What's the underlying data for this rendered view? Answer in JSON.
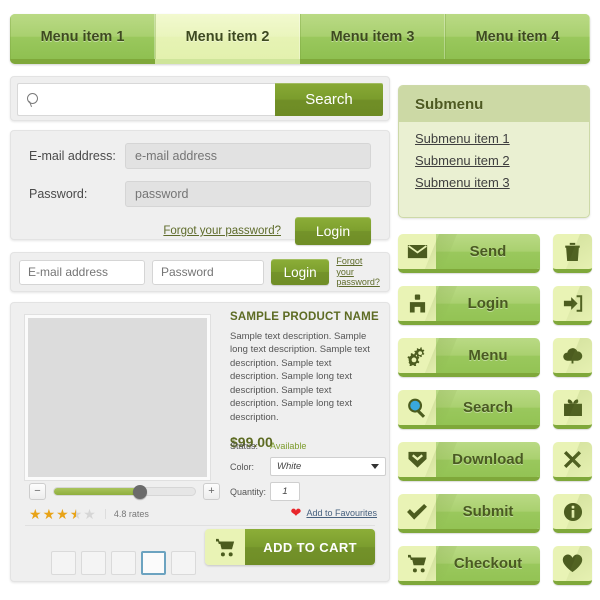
{
  "menu": {
    "items": [
      {
        "label": "Menu item 1",
        "active": false
      },
      {
        "label": "Menu item 2",
        "active": true
      },
      {
        "label": "Menu item 3",
        "active": false
      },
      {
        "label": "Menu item 4",
        "active": false
      }
    ]
  },
  "search": {
    "icon": "search-icon",
    "value": "",
    "placeholder": "",
    "button_label": "Search"
  },
  "login_form": {
    "email_label": "E-mail address:",
    "email_placeholder": "e-mail address",
    "email_value": "",
    "password_label": "Password:",
    "password_placeholder": "password",
    "password_value": "",
    "forgot_label": "Forgot your password?",
    "login_label": "Login"
  },
  "login_bar": {
    "email_placeholder": "E-mail address",
    "email_value": "",
    "password_placeholder": "Password",
    "password_value": "",
    "login_label": "Login",
    "forgot_label": "Forgot your password?"
  },
  "product": {
    "title": "SAMPLE PRODUCT NAME",
    "description": "Sample text description. Sample long text description. Sample text description. Sample text description. Sample long text description. Sample text description. Sample long text description.",
    "price": "$99.00",
    "status_label": "Status:",
    "status_value": "Available",
    "color_label": "Color:",
    "color_value": "White",
    "quantity_label": "Quantity:",
    "quantity_value": "1",
    "thumbnails": [
      {
        "selected": false
      },
      {
        "selected": false
      },
      {
        "selected": false
      },
      {
        "selected": true
      },
      {
        "selected": false
      }
    ],
    "slider": {
      "minus_label": "−",
      "plus_label": "+",
      "percent": 60
    },
    "rating": {
      "stars": [
        1,
        1,
        1,
        0.5,
        0
      ],
      "text": "4.8 rates"
    },
    "favourites": {
      "icon": "heart-icon",
      "label": "Add to Favourites"
    },
    "add_to_cart": {
      "icon": "cart-icon",
      "label": "ADD TO CART"
    }
  },
  "submenu": {
    "title": "Submenu",
    "items": [
      "Submenu item 1",
      "Submenu item 2",
      "Submenu item 3"
    ]
  },
  "buttons": {
    "rows": [
      {
        "label": "Send",
        "icon": "envelope-icon",
        "square_icon": "trash-icon"
      },
      {
        "label": "Login",
        "icon": "user-icon",
        "square_icon": "login-arrow-icon"
      },
      {
        "label": "Menu",
        "icon": "gears-icon",
        "square_icon": "cloud-upload-icon"
      },
      {
        "label": "Search",
        "icon": "magnifier-icon",
        "square_icon": "gift-icon"
      },
      {
        "label": "Download",
        "icon": "download-badge-icon",
        "square_icon": "close-x-icon"
      },
      {
        "label": "Submit",
        "icon": "checkmark-icon",
        "square_icon": "info-icon"
      },
      {
        "label": "Checkout",
        "icon": "cart-icon",
        "square_icon": "heart-icon"
      }
    ]
  },
  "colors": {
    "accent_green": "#8fbf52",
    "dark_green": "#7fa83a",
    "button_green": "#7b9d2e",
    "pale_green": "#e9f3b5",
    "active_tab": "#eaf5bd",
    "olive_text": "#5d6b23",
    "panel_bg": "#efefef",
    "star_gold": "#e8a317",
    "heart_red": "#e8262b",
    "link_blue": "#46607e"
  }
}
